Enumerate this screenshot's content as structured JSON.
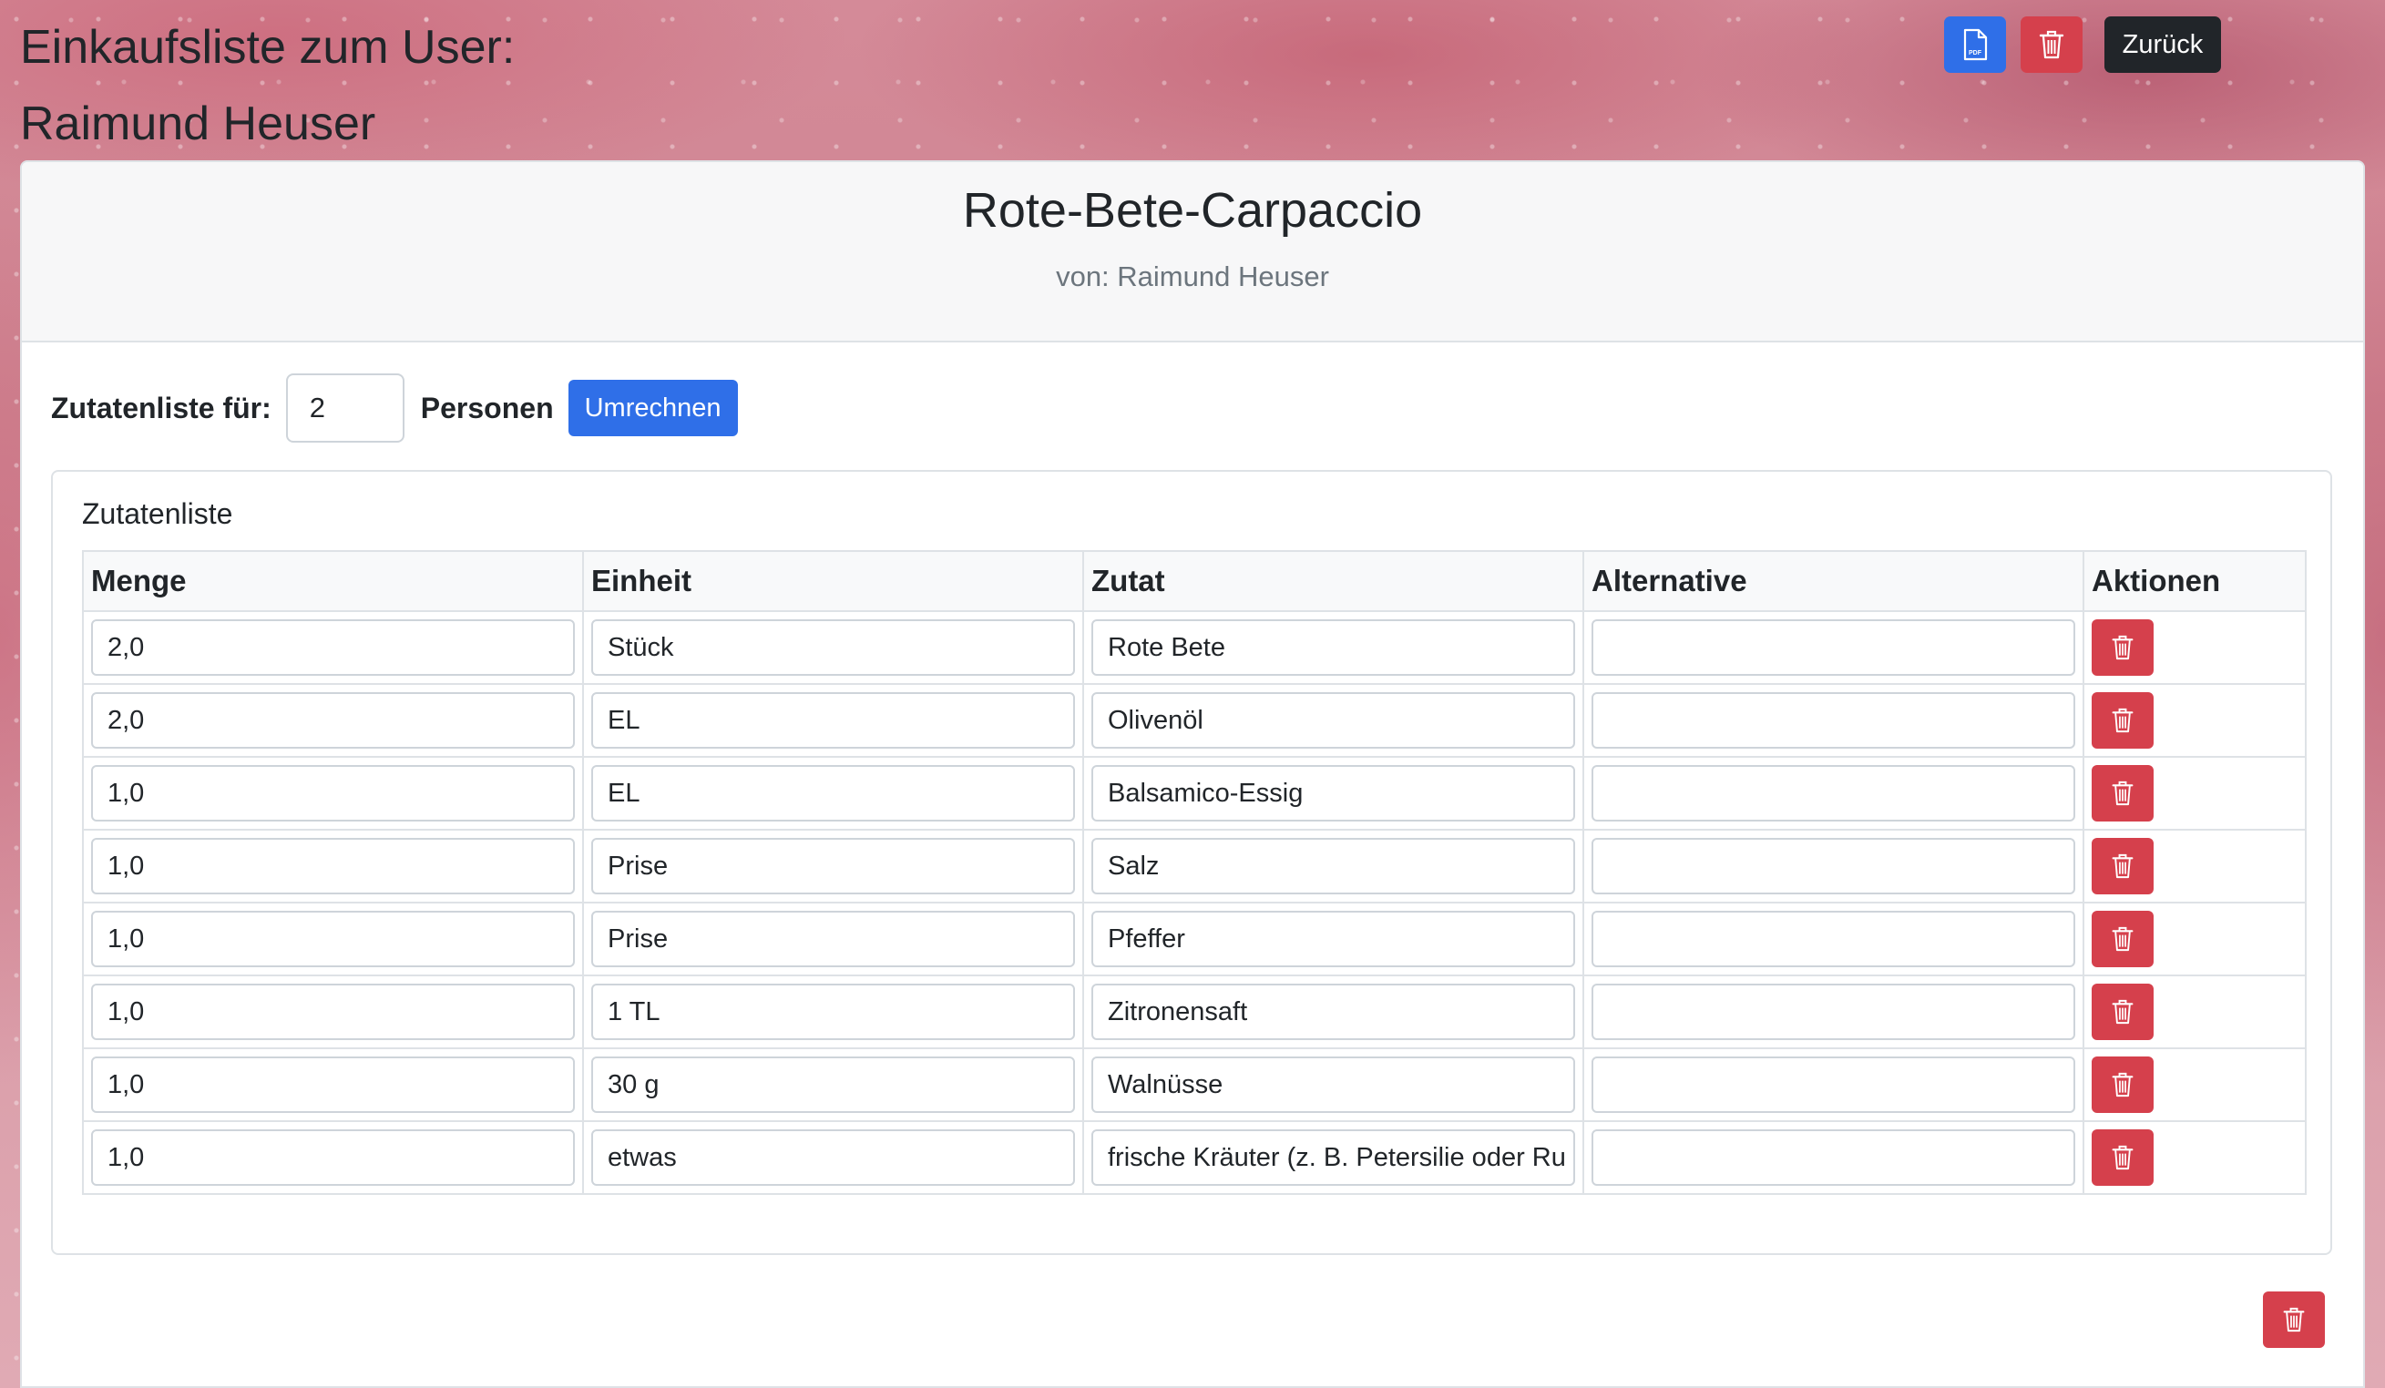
{
  "header": {
    "title_line1": "Einkaufsliste zum User:",
    "title_line2": "Raimund Heuser",
    "back_label": "Zurück",
    "pdf_icon_text": "PDF"
  },
  "recipe": {
    "title": "Rote-Bete-Carpaccio",
    "author": "von: Raimund Heuser"
  },
  "persons": {
    "label": "Zutatenliste für:",
    "value": "2",
    "unit_label": "Personen",
    "convert_label": "Umrechnen"
  },
  "ingredients": {
    "title": "Zutatenliste",
    "columns": [
      "Menge",
      "Einheit",
      "Zutat",
      "Alternative",
      "Aktionen"
    ],
    "rows": [
      {
        "menge": "2,0",
        "einheit": "Stück",
        "zutat": "Rote Bete",
        "alternative": ""
      },
      {
        "menge": "2,0",
        "einheit": "EL",
        "zutat": "Olivenöl",
        "alternative": ""
      },
      {
        "menge": "1,0",
        "einheit": "EL",
        "zutat": "Balsamico-Essig",
        "alternative": ""
      },
      {
        "menge": "1,0",
        "einheit": "Prise",
        "zutat": "Salz",
        "alternative": ""
      },
      {
        "menge": "1,0",
        "einheit": "Prise",
        "zutat": "Pfeffer",
        "alternative": ""
      },
      {
        "menge": "1,0",
        "einheit": "1 TL",
        "zutat": "Zitronensaft",
        "alternative": ""
      },
      {
        "menge": "1,0",
        "einheit": "30 g",
        "zutat": "Walnüsse",
        "alternative": ""
      },
      {
        "menge": "1,0",
        "einheit": "etwas",
        "zutat": "frische Kräuter (z. B. Petersilie oder Ru",
        "alternative": ""
      }
    ]
  },
  "colors": {
    "primary": "#2f6fe8",
    "danger": "#d5404c",
    "dark": "#212529"
  }
}
